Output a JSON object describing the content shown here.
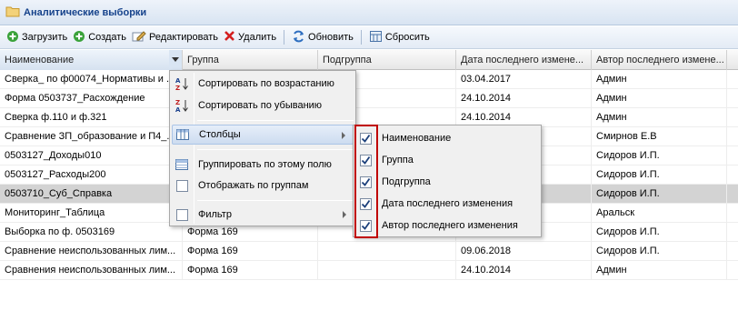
{
  "window": {
    "title": "Аналитические выборки",
    "title_icon": "folder-icon"
  },
  "toolbar": {
    "load_label": "Загрузить",
    "create_label": "Создать",
    "edit_label": "Редактировать",
    "delete_label": "Удалить",
    "refresh_label": "Обновить",
    "reset_label": "Сбросить"
  },
  "grid": {
    "columns": [
      "Наименование",
      "Группа",
      "Подгруппа",
      "Дата последнего измене...",
      "Автор последнего измене..."
    ],
    "rows": [
      {
        "name": "Сверка_ по ф00074_Нормативы и ...",
        "group": "",
        "subgroup": "",
        "date": "03.04.2017",
        "author": "Админ"
      },
      {
        "name": "Форма 0503737_Расхождение",
        "group": "",
        "subgroup": "",
        "date": "24.10.2014",
        "author": "Админ"
      },
      {
        "name": "Сверка ф.110 и ф.321",
        "group": "",
        "subgroup": "",
        "date": "24.10.2014",
        "author": "Админ"
      },
      {
        "name": "Сравнение ЗП_образование и П4_...",
        "group": "",
        "subgroup": "",
        "date": "",
        "author": "Смирнов Е.В"
      },
      {
        "name": "0503127_Доходы010",
        "group": "",
        "subgroup": "",
        "date": "",
        "author": "Сидоров И.П."
      },
      {
        "name": "0503127_Расходы200",
        "group": "",
        "subgroup": "",
        "date": "",
        "author": "Сидоров И.П."
      },
      {
        "name": "0503710_Суб_Справка",
        "group": "",
        "subgroup": "",
        "date": "",
        "author": "Сидоров И.П."
      },
      {
        "name": "Мониторинг_Таблица",
        "group": "",
        "subgroup": "",
        "date": "",
        "author": "Аральск"
      },
      {
        "name": "Выборка по ф. 0503169",
        "group": "Форма 169",
        "subgroup": "",
        "date": "",
        "author": "Сидоров И.П."
      },
      {
        "name": "Сравнение неиспользованных лим...",
        "group": "Форма 169",
        "subgroup": "",
        "date": "09.06.2018",
        "author": "Сидоров И.П."
      },
      {
        "name": "Сравнения неиспользованных лим...",
        "group": "Форма 169",
        "subgroup": "",
        "date": "24.10.2014",
        "author": "Админ"
      }
    ],
    "selected_row": 6
  },
  "context_menu": {
    "sort_asc": "Сортировать по возрастанию",
    "sort_desc": "Сортировать по убыванию",
    "columns": "Столбцы",
    "group_by": "Группировать по этому полю",
    "show_groups": "Отображать по группам",
    "filter": "Фильтр"
  },
  "columns_submenu": {
    "items": [
      {
        "label": "Наименование",
        "checked": true
      },
      {
        "label": "Группа",
        "checked": true
      },
      {
        "label": "Подгруппа",
        "checked": true
      },
      {
        "label": "Дата последнего изменения",
        "checked": true
      },
      {
        "label": "Автор последнего изменения",
        "checked": true
      }
    ]
  },
  "colors": {
    "accent": "#15428b",
    "highlight_frame": "#c00000",
    "selected_row": "#d3d3d3"
  }
}
